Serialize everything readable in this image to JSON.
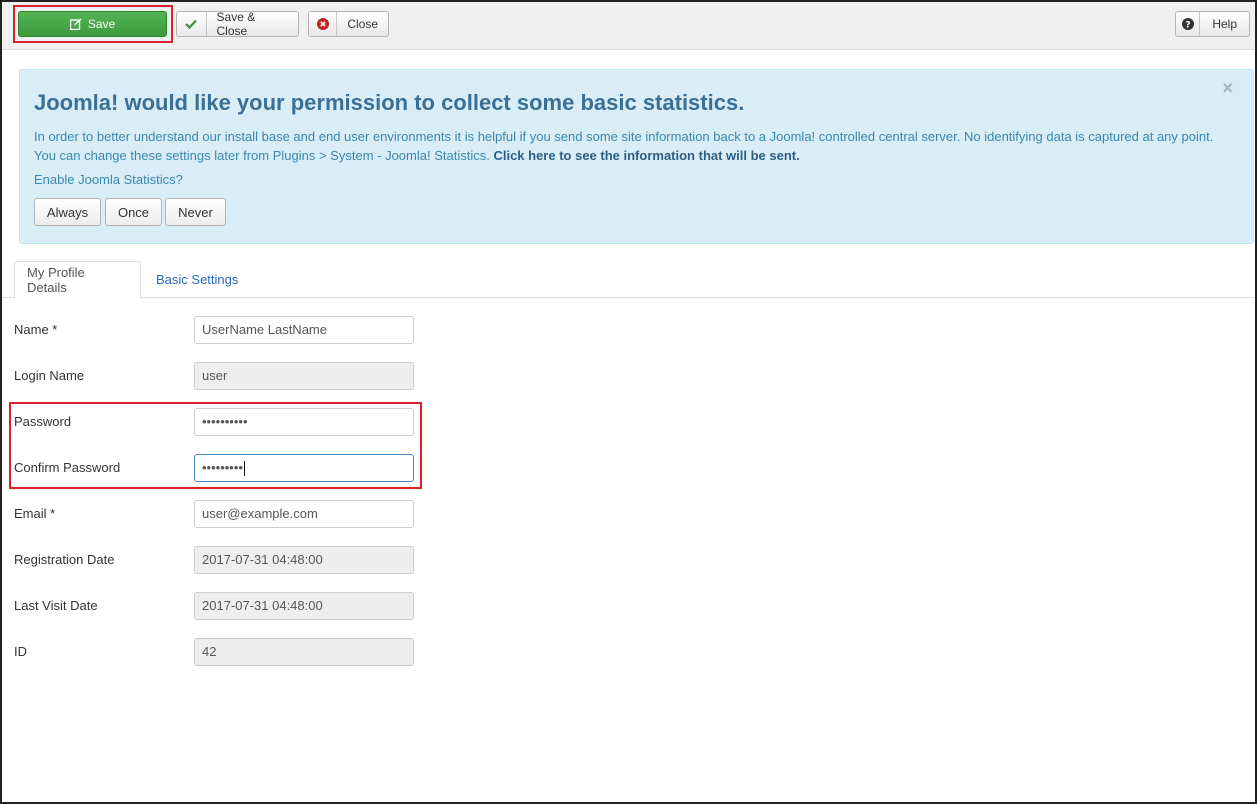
{
  "toolbar": {
    "save_label": "Save",
    "save_close_label": "Save & Close",
    "close_label": "Close",
    "help_label": "Help"
  },
  "stats_alert": {
    "title": "Joomla! would like your permission to collect some basic statistics.",
    "body": "In order to better understand our install base and end user environments it is helpful if you send some site information back to a Joomla! controlled central server. No identifying data is captured at any point. You can change these settings later from Plugins > System - Joomla! Statistics.",
    "link_text": "Click here to see the information that will be sent.",
    "question": "Enable Joomla Statistics?",
    "close_symbol": "×",
    "options": [
      "Always",
      "Once",
      "Never"
    ]
  },
  "tabs": [
    "My Profile Details",
    "Basic Settings"
  ],
  "form": {
    "name": {
      "label": "Name *",
      "value": "UserName LastName"
    },
    "login_name": {
      "label": "Login Name",
      "value": "user"
    },
    "password": {
      "label": "Password",
      "value": "••••••••••"
    },
    "confirm_password": {
      "label": "Confirm Password",
      "value": "•••••••••"
    },
    "email": {
      "label": "Email *",
      "value": "user@example.com"
    },
    "registration_date": {
      "label": "Registration Date",
      "value": "2017-07-31 04:48:00"
    },
    "last_visit_date": {
      "label": "Last Visit Date",
      "value": "2017-07-31 04:48:00"
    },
    "id": {
      "label": "ID",
      "value": "42"
    }
  },
  "colors": {
    "save_green": "#46a546",
    "highlight_red": "#d9232d",
    "alert_bg": "#d9edf7",
    "alert_title": "#3a6f96",
    "tab_link": "#2a69b8"
  }
}
